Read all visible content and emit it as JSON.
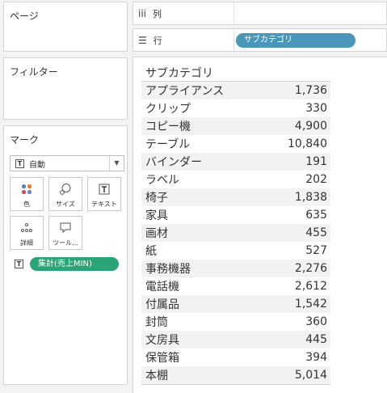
{
  "pages_card": {
    "title": "ページ"
  },
  "filters_card": {
    "title": "フィルター"
  },
  "marks_card": {
    "title": "マーク",
    "mark_type": "自動",
    "buttons": [
      {
        "label": "色",
        "icon": "color-icon"
      },
      {
        "label": "サイズ",
        "icon": "size-icon"
      },
      {
        "label": "テキスト",
        "icon": "text-icon"
      },
      {
        "label": "詳細",
        "icon": "detail-icon"
      },
      {
        "label": "ツール...",
        "icon": "tooltip-icon"
      }
    ],
    "text_field_pill": "集計(売上MIN)"
  },
  "shelves": {
    "columns": {
      "symbol": "iii",
      "label": "列"
    },
    "rows": {
      "symbol": "☰",
      "label": "行",
      "pill": "サブカテゴリ"
    }
  },
  "table": {
    "header": "サブカテゴリ",
    "rows": [
      {
        "category": "アプライアンス",
        "value": "1,736"
      },
      {
        "category": "クリップ",
        "value": "330"
      },
      {
        "category": "コピー機",
        "value": "4,900"
      },
      {
        "category": "テーブル",
        "value": "10,840"
      },
      {
        "category": "バインダー",
        "value": "191"
      },
      {
        "category": "ラベル",
        "value": "202"
      },
      {
        "category": "椅子",
        "value": "1,838"
      },
      {
        "category": "家具",
        "value": "635"
      },
      {
        "category": "画材",
        "value": "455"
      },
      {
        "category": "紙",
        "value": "527"
      },
      {
        "category": "事務機器",
        "value": "2,276"
      },
      {
        "category": "電話機",
        "value": "2,612"
      },
      {
        "category": "付属品",
        "value": "1,542"
      },
      {
        "category": "封筒",
        "value": "360"
      },
      {
        "category": "文房具",
        "value": "445"
      },
      {
        "category": "保管箱",
        "value": "394"
      },
      {
        "category": "本棚",
        "value": "5,014"
      }
    ]
  },
  "colors": {
    "rows_pill": "#4a96b8",
    "measure_pill": "#2ba578"
  }
}
